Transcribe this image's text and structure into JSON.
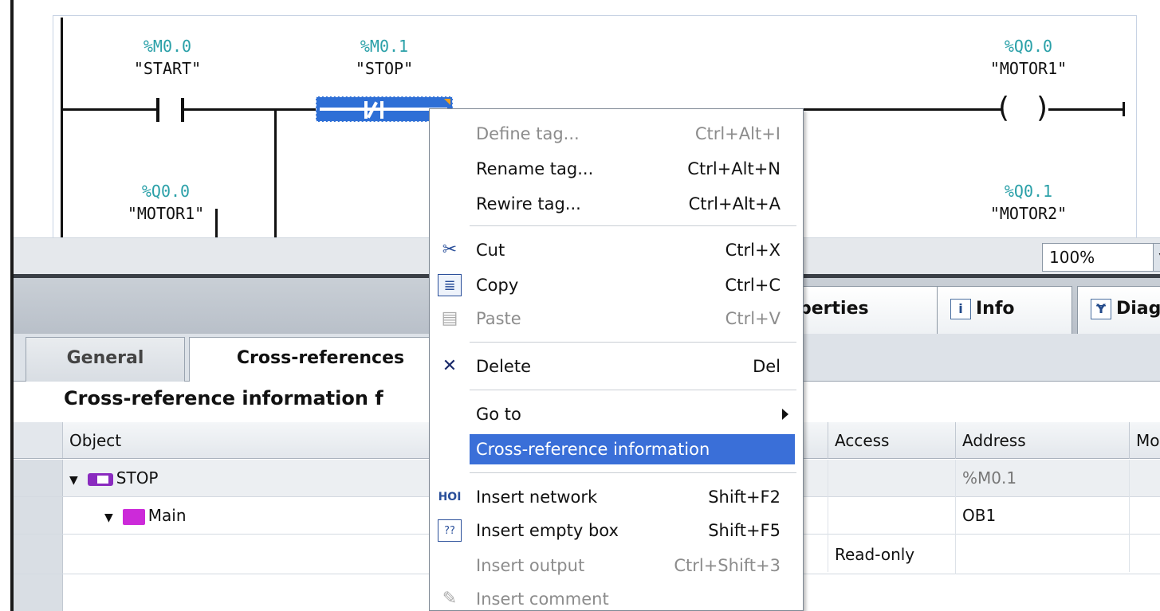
{
  "editor": {
    "contacts": [
      {
        "address": "%M0.0",
        "symbol": "\"START\""
      },
      {
        "address": "%M0.1",
        "symbol": "\"STOP\""
      },
      {
        "address": "%Q0.0",
        "symbol": "\"MOTOR1\""
      }
    ],
    "coils": [
      {
        "address": "%Q0.0",
        "symbol": "\"MOTOR1\""
      },
      {
        "address": "%Q0.1",
        "symbol": "\"MOTOR2\""
      }
    ],
    "zoom": "100%"
  },
  "inspector": {
    "tabs": [
      "perties",
      "Info",
      "Diag"
    ],
    "subtabs": [
      "General",
      "Cross-references"
    ],
    "title": "Cross-reference information f",
    "columns": [
      "Object",
      "Access",
      "Address",
      "Mo"
    ],
    "rows": [
      {
        "object": "STOP",
        "access": "",
        "address": "%M0.1"
      },
      {
        "object": "Main",
        "access": "",
        "address": "OB1"
      },
      {
        "object": "",
        "access": "Read-only",
        "address": ""
      }
    ]
  },
  "context_menu": {
    "items": [
      {
        "label": "Define tag...",
        "shortcut": "Ctrl+Alt+I",
        "disabled": true,
        "icon": ""
      },
      {
        "label": "Rename tag...",
        "shortcut": "Ctrl+Alt+N",
        "disabled": false,
        "icon": ""
      },
      {
        "label": "Rewire tag...",
        "shortcut": "Ctrl+Alt+A",
        "disabled": false,
        "icon": ""
      },
      {
        "label": "Cut",
        "shortcut": "Ctrl+X",
        "disabled": false,
        "icon": "scissors-icon"
      },
      {
        "label": "Copy",
        "shortcut": "Ctrl+C",
        "disabled": false,
        "icon": "copy-icon"
      },
      {
        "label": "Paste",
        "shortcut": "Ctrl+V",
        "disabled": true,
        "icon": "paste-icon"
      },
      {
        "label": "Delete",
        "shortcut": "Del",
        "disabled": false,
        "icon": "delete-icon"
      },
      {
        "label": "Go to",
        "shortcut": "",
        "disabled": false,
        "icon": ""
      },
      {
        "label": "Cross-reference information",
        "shortcut": "",
        "disabled": false,
        "icon": ""
      },
      {
        "label": "Insert network",
        "shortcut": "Shift+F2",
        "disabled": false,
        "icon": "insert-network-icon"
      },
      {
        "label": "Insert empty box",
        "shortcut": "Shift+F5",
        "disabled": false,
        "icon": "empty-box-icon"
      },
      {
        "label": "Insert output",
        "shortcut": "Ctrl+Shift+3",
        "disabled": true,
        "icon": ""
      },
      {
        "label": "Insert comment",
        "shortcut": "",
        "disabled": true,
        "icon": "comment-icon"
      }
    ],
    "icon_glyphs": {
      "cut": "✂",
      "copy": "≣",
      "paste": "▤",
      "delete": "✕",
      "empty_box": "??"
    }
  },
  "colors": {
    "selection": "#3a6fd8",
    "address_teal": "#2aa0a8",
    "accent_orange": "#f0a020"
  }
}
